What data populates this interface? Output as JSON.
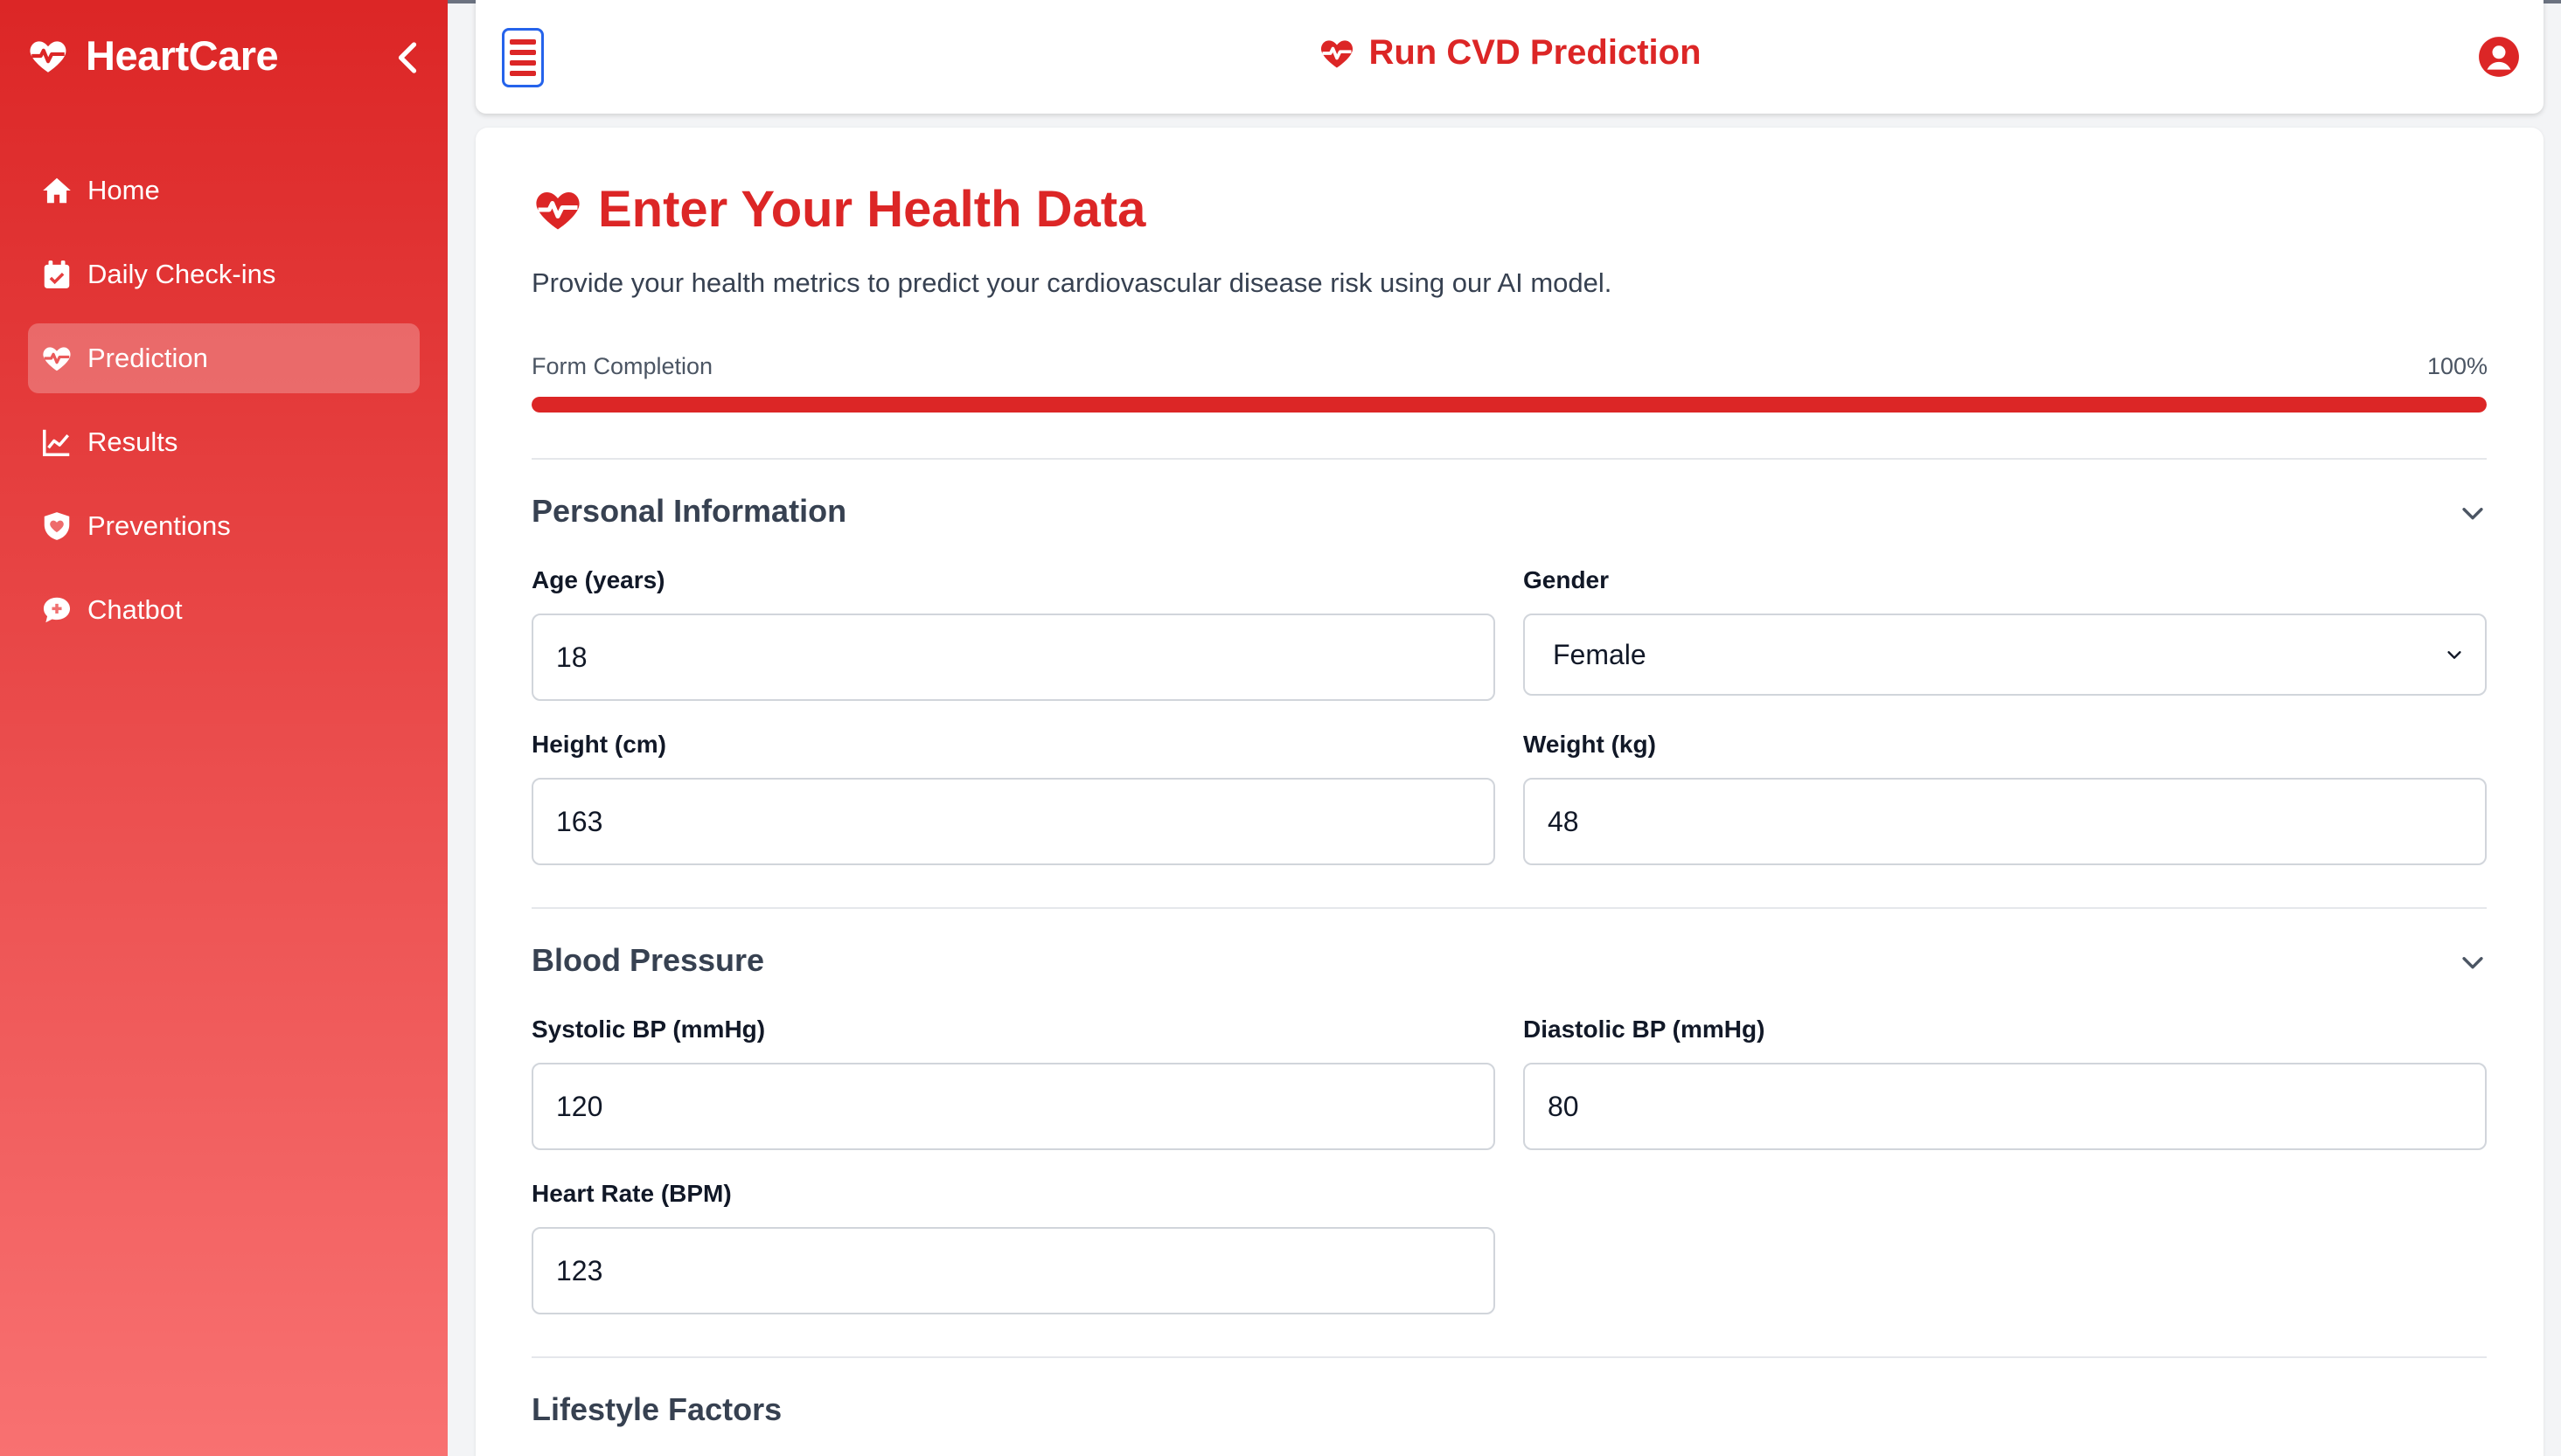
{
  "sidebar": {
    "brand": "HeartCare",
    "items": [
      {
        "label": "Home",
        "icon": "home-icon"
      },
      {
        "label": "Daily Check-ins",
        "icon": "calendar-check-icon"
      },
      {
        "label": "Prediction",
        "icon": "heartbeat-icon",
        "active": true
      },
      {
        "label": "Results",
        "icon": "chart-line-icon"
      },
      {
        "label": "Preventions",
        "icon": "shield-icon"
      },
      {
        "label": "Chatbot",
        "icon": "chat-icon"
      }
    ]
  },
  "topbar": {
    "title": "Run CVD Prediction"
  },
  "main": {
    "title": "Enter Your Health Data",
    "description": "Provide your health metrics to predict your cardiovascular disease risk using our AI model.",
    "progress": {
      "label": "Form Completion",
      "percent_text": "100%",
      "value": 100
    },
    "sections": {
      "personal": {
        "title": "Personal Information",
        "age": {
          "label": "Age (years)",
          "value": "18"
        },
        "gender": {
          "label": "Gender",
          "value": "Female"
        },
        "height": {
          "label": "Height (cm)",
          "value": "163"
        },
        "weight": {
          "label": "Weight (kg)",
          "value": "48"
        }
      },
      "bp": {
        "title": "Blood Pressure",
        "systolic": {
          "label": "Systolic BP (mmHg)",
          "value": "120"
        },
        "diastolic": {
          "label": "Diastolic BP (mmHg)",
          "value": "80"
        },
        "heart_rate": {
          "label": "Heart Rate (BPM)",
          "value": "123"
        }
      },
      "lifestyle": {
        "title": "Lifestyle Factors"
      }
    }
  },
  "colors": {
    "accent": "#dc2626",
    "sidebar_top": "#dc2626",
    "sidebar_bottom": "#f87171"
  }
}
